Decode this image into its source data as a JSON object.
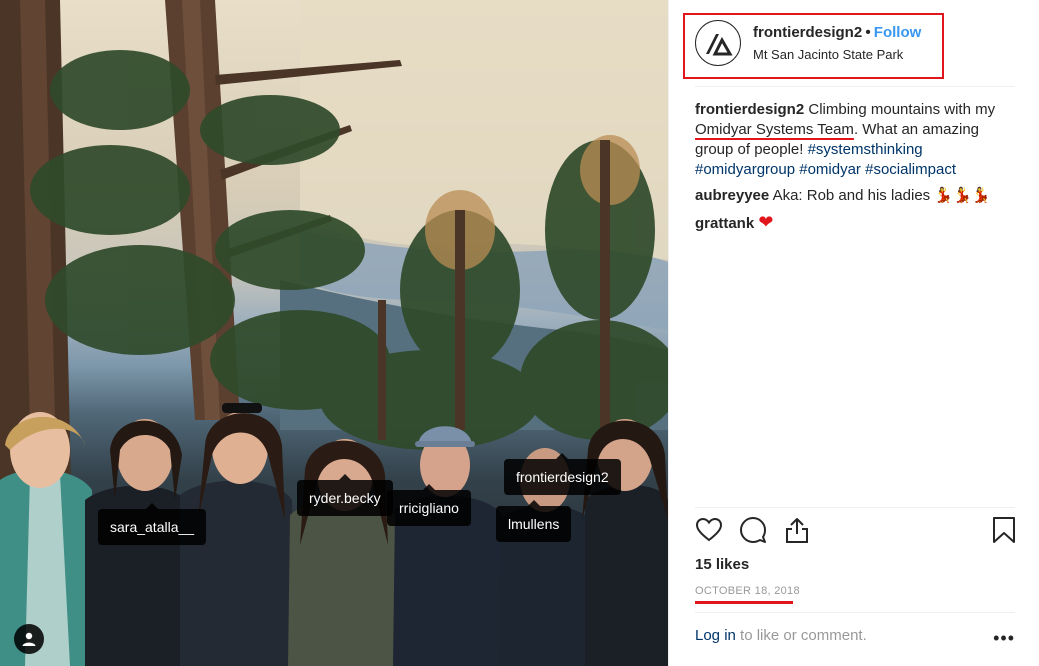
{
  "post": {
    "username": "frontierdesign2",
    "follow_label": "Follow",
    "location": "Mt San Jacinto State Park",
    "caption_user": "frontierdesign2",
    "caption_text_1": " Climbing mountains with my ",
    "caption_highlight": "Omidyar Systems Team",
    "caption_text_2": ". What an amazing group of people! ",
    "hashtags": [
      "#systemsthinking",
      "#omidyargroup",
      "#omidyar",
      "#socialimpact"
    ],
    "comments": [
      {
        "user": "aubreyyee",
        "text": "Aka: Rob and his ladies",
        "emoji": "💃💃💃"
      },
      {
        "user": "grattank",
        "text": "",
        "emoji": "❤"
      }
    ],
    "likes": "15 likes",
    "date": "OCTOBER 18, 2018",
    "login_link": "Log in",
    "login_rest": " to like or comment.",
    "more_label": "•••"
  },
  "photo_tags": [
    "sara_atalla__",
    "ryder.becky",
    "rricigliano",
    "frontierdesign2",
    "lmullens"
  ],
  "icons": {
    "avatar": "frontier-logo-icon",
    "like": "heart-icon",
    "comment": "comment-bubble-icon",
    "share": "share-icon",
    "save": "bookmark-icon",
    "tagged_users": "user-icon"
  },
  "colors": {
    "follow": "#3897f0",
    "hashtag": "#003569",
    "annotation": "#e0161c",
    "date": "#999999"
  }
}
